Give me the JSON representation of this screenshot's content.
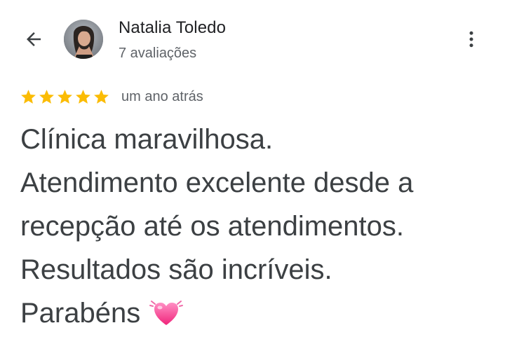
{
  "header": {
    "back_icon": "arrow-back-icon",
    "avatar_alt": "avatar",
    "reviewer_name": "Natalia Toledo",
    "review_count": "7 avaliações",
    "more_icon": "more-vert-icon"
  },
  "review": {
    "stars": 5,
    "star_color": "#fbbc04",
    "date": "um ano atrás",
    "lines": [
      "Clínica maravilhosa.",
      "Atendimento excelente desde a",
      "recepção até os atendimentos.",
      "Resultados são incríveis.",
      "Parabéns"
    ],
    "emoji": "heart-beating-icon"
  }
}
